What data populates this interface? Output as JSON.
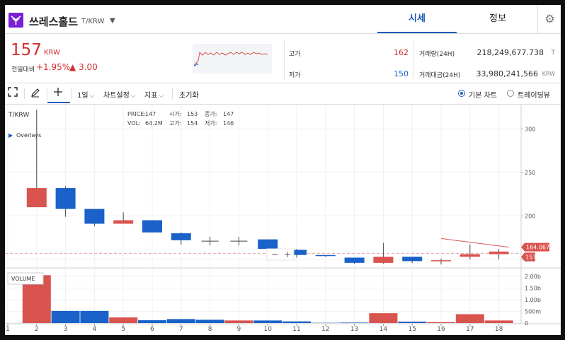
{
  "header": {
    "title": "쓰레스홀드",
    "pair": "T/KRW",
    "tab_price": "시세",
    "tab_info": "정보"
  },
  "quote": {
    "price": "157",
    "unit": "KRW",
    "change_label": "전일대비",
    "change_pct": "+1.95%",
    "change_abs": "▲ 3.00",
    "high_label": "고가",
    "high": "162",
    "low_label": "저가",
    "low": "150",
    "vol_label": "거래량(24H)",
    "vol": "218,249,677.738",
    "vol_unit": "T",
    "amount_label": "거래대금(24H)",
    "amount": "33,980,241,566",
    "amount_unit": "KRW"
  },
  "toolbar": {
    "period": "1일",
    "chart_settings": "차트설정",
    "indicators": "지표",
    "reset": "초기화",
    "basic_chart": "기본 차트",
    "tradingview": "트레이딩뷰"
  },
  "legend": {
    "pair": "T/KRW",
    "overlays": "Overlays",
    "price_label": "PRICE:",
    "price": "147",
    "open_label": "시가:",
    "open": "153",
    "close_label": "종가:",
    "close": "147",
    "vol_label": "VOL:",
    "vol": "64.2M",
    "high_label": "고가:",
    "high": "154",
    "low_label": "저가:",
    "low": "146"
  },
  "colors": {
    "up": "#d9534f",
    "down": "#1a62c9",
    "accent": "#1d5bb8"
  },
  "chart_data": {
    "type": "candlestick",
    "x": [
      1,
      2,
      3,
      4,
      5,
      6,
      7,
      8,
      9,
      10,
      11,
      12,
      13,
      14,
      15,
      16,
      17,
      18
    ],
    "candles": [
      {
        "x": 2,
        "open": 210,
        "close": 232,
        "high": 322,
        "low": 210
      },
      {
        "x": 3,
        "open": 232,
        "close": 208,
        "high": 234,
        "low": 199
      },
      {
        "x": 4,
        "open": 208,
        "close": 191,
        "high": 208,
        "low": 188
      },
      {
        "x": 5,
        "open": 191,
        "close": 195,
        "high": 204,
        "low": 191
      },
      {
        "x": 6,
        "open": 195,
        "close": 181,
        "high": 195,
        "low": 181
      },
      {
        "x": 7,
        "open": 180,
        "close": 172,
        "high": 181,
        "low": 167
      },
      {
        "x": 8,
        "open": 171,
        "close": 171,
        "high": 176,
        "low": 166
      },
      {
        "x": 9,
        "open": 171,
        "close": 171,
        "high": 176,
        "low": 166
      },
      {
        "x": 10,
        "open": 173,
        "close": 162,
        "high": 173,
        "low": 160
      },
      {
        "x": 11,
        "open": 161,
        "close": 155,
        "high": 162,
        "low": 152
      },
      {
        "x": 12,
        "open": 155,
        "close": 154,
        "high": 155,
        "low": 153
      },
      {
        "x": 13,
        "open": 152,
        "close": 146,
        "high": 152,
        "low": 145
      },
      {
        "x": 14,
        "open": 146,
        "close": 153,
        "high": 169,
        "low": 145
      },
      {
        "x": 15,
        "open": 153,
        "close": 148,
        "high": 153,
        "low": 146
      },
      {
        "x": 16,
        "open": 148,
        "close": 149,
        "high": 151,
        "low": 144
      },
      {
        "x": 17,
        "open": 153,
        "close": 156,
        "high": 167,
        "low": 150
      },
      {
        "x": 18,
        "open": 156,
        "close": 159,
        "high": 162,
        "low": 150
      }
    ],
    "volume": [
      {
        "x": 2,
        "v": 2.05,
        "dir": "up"
      },
      {
        "x": 3,
        "v": 0.52,
        "dir": "down"
      },
      {
        "x": 4,
        "v": 0.52,
        "dir": "down"
      },
      {
        "x": 5,
        "v": 0.24,
        "dir": "up"
      },
      {
        "x": 6,
        "v": 0.12,
        "dir": "down"
      },
      {
        "x": 7,
        "v": 0.17,
        "dir": "down"
      },
      {
        "x": 8,
        "v": 0.14,
        "dir": "down"
      },
      {
        "x": 9,
        "v": 0.11,
        "dir": "up"
      },
      {
        "x": 10,
        "v": 0.11,
        "dir": "down"
      },
      {
        "x": 11,
        "v": 0.07,
        "dir": "down"
      },
      {
        "x": 12,
        "v": 0.01,
        "dir": "down"
      },
      {
        "x": 13,
        "v": 0.02,
        "dir": "down"
      },
      {
        "x": 14,
        "v": 0.42,
        "dir": "up"
      },
      {
        "x": 15,
        "v": 0.06,
        "dir": "down"
      },
      {
        "x": 16,
        "v": 0.04,
        "dir": "up"
      },
      {
        "x": 17,
        "v": 0.38,
        "dir": "up"
      },
      {
        "x": 18,
        "v": 0.11,
        "dir": "up"
      }
    ],
    "price_ticks": [
      150,
      200,
      250,
      300
    ],
    "volume_tick_labels": [
      "0",
      "500m",
      "1.00b",
      "1.50b",
      "2.00b"
    ],
    "volume_tick_values": [
      0,
      0.5,
      1.0,
      1.5,
      2.0
    ],
    "volume_title": "VOLUME",
    "ylim": [
      141,
      328
    ],
    "vlim": [
      0,
      2.15
    ],
    "current_price": 157,
    "current_price_label": "157",
    "marker_label": "164.067",
    "trendline": {
      "x1": 16,
      "y1": 174,
      "x2": 18,
      "y2": 164.067
    }
  }
}
